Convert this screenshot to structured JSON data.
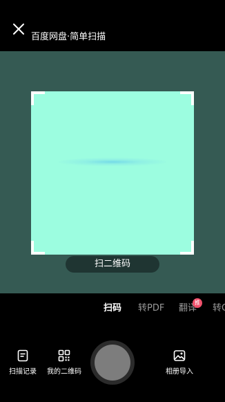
{
  "header": {
    "title": "百度网盘·简单扫描"
  },
  "scanner": {
    "mode_label": "扫二维码"
  },
  "tabs": [
    {
      "label": "扫码",
      "active": true
    },
    {
      "label": "转PDF",
      "active": false
    },
    {
      "label": "翻译",
      "active": false,
      "badge": "推"
    },
    {
      "label": "转O",
      "active": false
    }
  ],
  "toolbar": {
    "history_label": "扫描记录",
    "my_qrcode_label": "我的二维码",
    "album_import_label": "相册导入"
  },
  "colors": {
    "preview_bg": "#355a53",
    "scan_area": "#9cfde0",
    "badge": "#f0506b",
    "shutter_inner": "#7d7d7d"
  },
  "icons": {
    "close": "close-icon",
    "history": "document-icon",
    "my_qrcode": "qrcode-icon",
    "album": "image-icon"
  }
}
